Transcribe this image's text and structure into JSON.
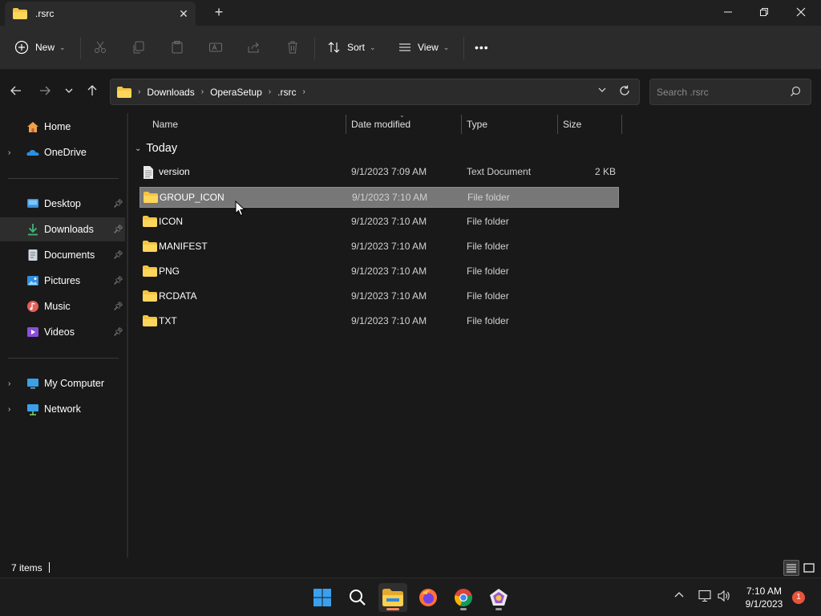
{
  "window": {
    "tab_title": ".rsrc",
    "tab_close": "✕",
    "new_tab": "+"
  },
  "toolbar": {
    "new_label": "New",
    "sort_label": "Sort",
    "view_label": "View",
    "more_label": "•••"
  },
  "address": {
    "crumbs": [
      "Downloads",
      "OperaSetup",
      ".rsrc"
    ],
    "search_placeholder": "Search .rsrc"
  },
  "sidebar": {
    "items": [
      {
        "label": "Home",
        "icon": "home-icon"
      },
      {
        "label": "OneDrive",
        "icon": "onedrive-icon"
      },
      {
        "label": "Desktop",
        "icon": "desktop-icon"
      },
      {
        "label": "Downloads",
        "icon": "downloads-icon"
      },
      {
        "label": "Documents",
        "icon": "documents-icon"
      },
      {
        "label": "Pictures",
        "icon": "pictures-icon"
      },
      {
        "label": "Music",
        "icon": "music-icon"
      },
      {
        "label": "Videos",
        "icon": "videos-icon"
      },
      {
        "label": "My Computer",
        "icon": "computer-icon"
      },
      {
        "label": "Network",
        "icon": "network-icon"
      }
    ]
  },
  "columns": {
    "name": "Name",
    "date": "Date modified",
    "type": "Type",
    "size": "Size"
  },
  "group_label": "Today",
  "files": [
    {
      "name": "version",
      "date": "9/1/2023 7:09 AM",
      "type": "Text Document",
      "size": "2 KB",
      "icon": "text-file-icon"
    },
    {
      "name": "GROUP_ICON",
      "date": "9/1/2023 7:10 AM",
      "type": "File folder",
      "size": "",
      "icon": "folder-icon"
    },
    {
      "name": "ICON",
      "date": "9/1/2023 7:10 AM",
      "type": "File folder",
      "size": "",
      "icon": "folder-icon"
    },
    {
      "name": "MANIFEST",
      "date": "9/1/2023 7:10 AM",
      "type": "File folder",
      "size": "",
      "icon": "folder-icon"
    },
    {
      "name": "PNG",
      "date": "9/1/2023 7:10 AM",
      "type": "File folder",
      "size": "",
      "icon": "folder-icon"
    },
    {
      "name": "RCDATA",
      "date": "9/1/2023 7:10 AM",
      "type": "File folder",
      "size": "",
      "icon": "folder-icon"
    },
    {
      "name": "TXT",
      "date": "9/1/2023 7:10 AM",
      "type": "File folder",
      "size": "",
      "icon": "folder-icon"
    }
  ],
  "status": {
    "item_count": "7 items"
  },
  "taskbar": {
    "clock_time": "7:10 AM",
    "clock_date": "9/1/2023",
    "notification_count": "1"
  },
  "colors": {
    "folder": "#f4c542",
    "accent": "#f08a5d",
    "selection": "#777777"
  }
}
